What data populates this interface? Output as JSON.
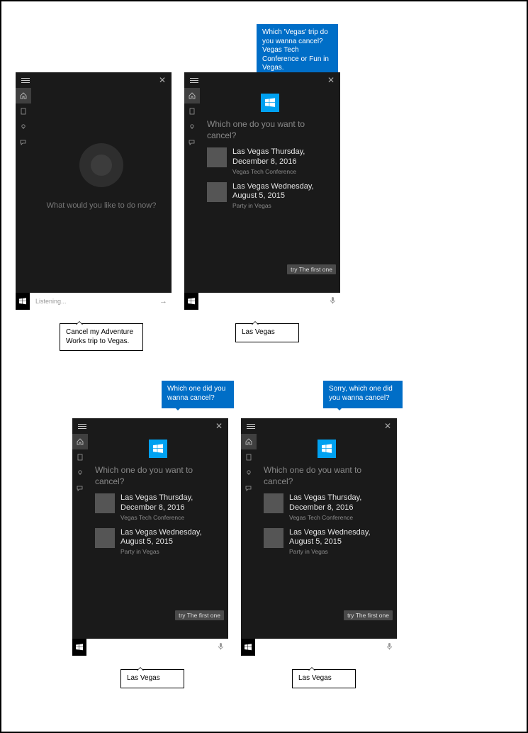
{
  "panel1": {
    "prompt": "What would you like to do now?",
    "input_placeholder": "Listening...",
    "user_bubble": "Cancel my Adventure Works trip to Vegas."
  },
  "panel2": {
    "voice_bubble": "Which 'Vegas' trip do you wanna cancel? Vegas Tech Conference or Fun in Vegas.",
    "question": "Which one do you want to cancel?",
    "trips": [
      {
        "title": "Las Vegas Thursday, December 8, 2016",
        "sub": "Vegas Tech Conference"
      },
      {
        "title": "Las Vegas Wednesday, August 5, 2015",
        "sub": "Party in Vegas"
      }
    ],
    "hint": "try The first one",
    "user_bubble": "Las Vegas"
  },
  "panel3": {
    "voice_bubble": "Which one did you wanna cancel?",
    "question": "Which one do you want to cancel?",
    "trips": [
      {
        "title": "Las Vegas Thursday, December 8, 2016",
        "sub": "Vegas Tech Conference"
      },
      {
        "title": "Las Vegas Wednesday, August 5, 2015",
        "sub": "Party in Vegas"
      }
    ],
    "hint": "try The first one",
    "user_bubble": "Las Vegas"
  },
  "panel4": {
    "voice_bubble": "Sorry, which one did you wanna cancel?",
    "question": "Which one do you want to cancel?",
    "trips": [
      {
        "title": "Las Vegas Thursday, December 8, 2016",
        "sub": "Vegas Tech Conference"
      },
      {
        "title": "Las Vegas Wednesday, August 5, 2015",
        "sub": "Party in Vegas"
      }
    ],
    "hint": "try The first one",
    "user_bubble": "Las Vegas"
  },
  "sidebar_icons": [
    "home-icon",
    "notebook-icon",
    "lightbulb-icon",
    "feedback-icon"
  ]
}
